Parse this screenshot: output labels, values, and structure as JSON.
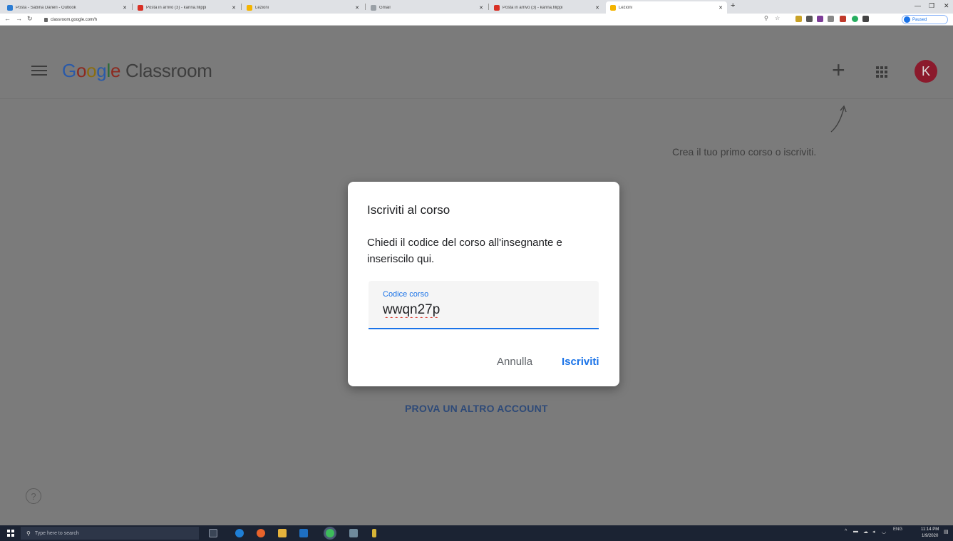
{
  "browser": {
    "tabs": [
      {
        "title": "Posta - Sabina Daneri - Outlook",
        "icon_color": "#2b7cd3"
      },
      {
        "title": "Posta in arrivo (3) - karina.filippi",
        "icon_color": "#d93025"
      },
      {
        "title": "Lezioni",
        "icon_color": "#f4b400"
      },
      {
        "title": "Gmail",
        "icon_color": "#9aa0a6"
      },
      {
        "title": "Posta in arrivo (3) - karina.filippi",
        "icon_color": "#d93025"
      },
      {
        "title": "Lezioni",
        "icon_color": "#f4b400"
      }
    ],
    "url": "classroom.google.com/h",
    "profile_status": "Paused"
  },
  "app": {
    "logo_prefix": "Google",
    "logo_suffix": " Classroom",
    "avatar_initial": "K",
    "avatar_color": "#8b1a2c",
    "hint": "Crea il tuo primo corso o iscriviti.",
    "other_account": "PROVA UN ALTRO ACCOUNT",
    "help_icon": "?"
  },
  "dialog": {
    "title": "Iscriviti al corso",
    "description": "Chiedi il codice del corso all'insegnante e inseriscilo qui.",
    "field_label": "Codice corso",
    "field_value": "wwqn27p",
    "cancel_label": "Annulla",
    "join_label": "Iscriviti"
  },
  "taskbar": {
    "search_placeholder": "Type here to search",
    "language": "ENG",
    "time": "11:14 PM",
    "date": "1/9/2020"
  }
}
